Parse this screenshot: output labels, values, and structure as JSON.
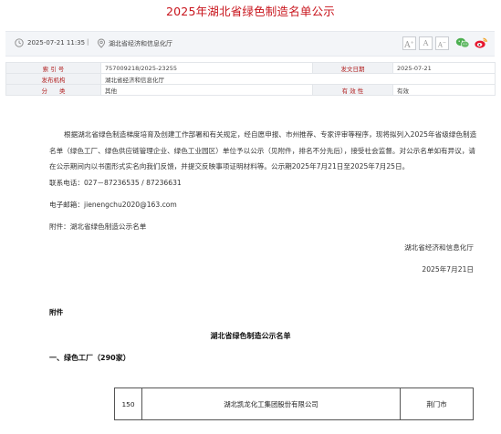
{
  "page": {
    "title": "2025年湖北省绿色制造名单公示"
  },
  "infobar": {
    "date": "2025-07-21 11:35",
    "separator": "|",
    "source": "湖北省经济和信息化厅",
    "font_large": "A",
    "font_medium": "A",
    "font_small": "A",
    "icons": [
      "clock-icon",
      "location-pin-icon",
      "wechat-icon",
      "weibo-icon"
    ]
  },
  "meta": {
    "rows": [
      {
        "k1": "索 引 号",
        "v1": "757009218/2025-23255",
        "k2": "发文日期",
        "v2": "2025-07-21"
      },
      {
        "k1": "发布机构",
        "v1": "湖北省经济和信息化厅",
        "k2": "",
        "v2": ""
      },
      {
        "k1": "分　　类",
        "v1": "其他",
        "k2": "有 效 性",
        "v2": "有效"
      }
    ]
  },
  "content": {
    "paragraph": "根据湖北省绿色制造梯度培育及创建工作部署和有关规定，经自愿申报、市州推荐、专家评审等程序，现将拟列入2025年省级绿色制造名单（绿色工厂、绿色供应链管理企业、绿色工业园区）单位予以公示（见附件，排名不分先后），接受社会监督。对公示名单如有异议，请在公示期间内以书面形式实名向我们反馈，并提交反映事项证明材料等。公示期2025年7月21日至2025年7月25日。",
    "phone": "联系电话：027－87236535 / 87236631",
    "email": "电子邮箱：jienengchu2020@163.com",
    "attachment": "附件：湖北省绿色制造公示名单",
    "signature_org": "湖北省经济和信息化厅",
    "signature_date": "2025年7月21日",
    "fujian_label": "附件",
    "list_title": "湖北省绿色制造公示名单",
    "section_title": "一、绿色工厂（290家）",
    "table_rows": [
      {
        "no": "150",
        "name": "湖北凯龙化工集团股份有限公司",
        "city": "荆门市"
      }
    ]
  }
}
